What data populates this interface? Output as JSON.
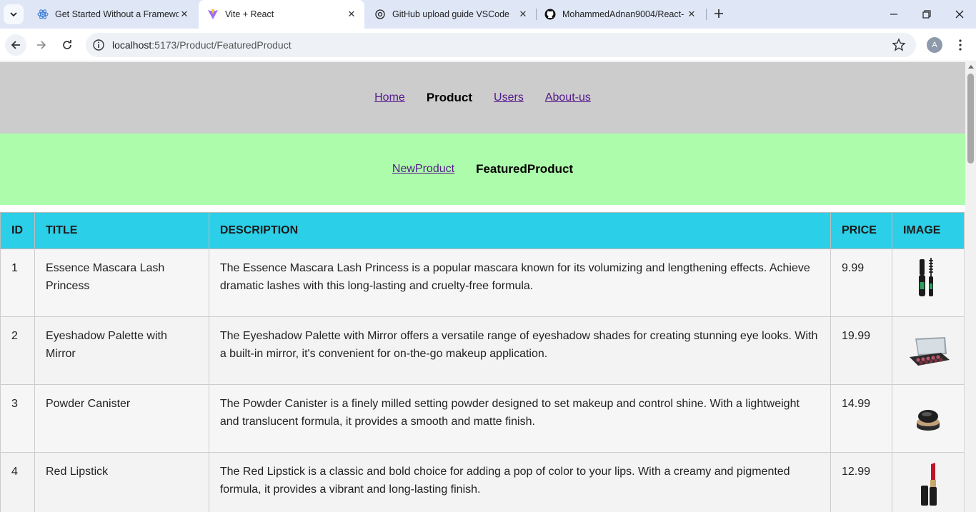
{
  "browser": {
    "tabs": [
      {
        "title": "Get Started Without a Framewo",
        "active": false,
        "icon": "react-icon"
      },
      {
        "title": "Vite + React",
        "active": true,
        "icon": "vite-icon"
      },
      {
        "title": "GitHub upload guide VSCode",
        "active": false,
        "icon": "chatgpt-icon"
      },
      {
        "title": "MohammedAdnan9004/React-",
        "active": false,
        "icon": "github-icon"
      }
    ],
    "url_host": "localhost",
    "url_path": ":5173/Product/FeaturedProduct",
    "profile_initial": "A"
  },
  "nav": {
    "home": "Home",
    "product": "Product",
    "users": "Users",
    "about": "About-us"
  },
  "subnav": {
    "new_product": "NewProduct",
    "featured_product": "FeaturedProduct"
  },
  "table": {
    "headers": [
      "ID",
      "TITLE",
      "DESCRIPTION",
      "PRICE",
      "IMAGE"
    ],
    "rows": [
      {
        "id": "1",
        "title": "Essence Mascara Lash Princess",
        "description": "The Essence Mascara Lash Princess is a popular mascara known for its volumizing and lengthening effects. Achieve dramatic lashes with this long-lasting and cruelty-free formula.",
        "price": "9.99",
        "image": "mascara-image"
      },
      {
        "id": "2",
        "title": "Eyeshadow Palette with Mirror",
        "description": "The Eyeshadow Palette with Mirror offers a versatile range of eyeshadow shades for creating stunning eye looks. With a built-in mirror, it's convenient for on-the-go makeup application.",
        "price": "19.99",
        "image": "eyeshadow-palette-image"
      },
      {
        "id": "3",
        "title": "Powder Canister",
        "description": "The Powder Canister is a finely milled setting powder designed to set makeup and control shine. With a lightweight and translucent formula, it provides a smooth and matte finish.",
        "price": "14.99",
        "image": "powder-canister-image"
      },
      {
        "id": "4",
        "title": "Red Lipstick",
        "description": "The Red Lipstick is a classic and bold choice for adding a pop of color to your lips. With a creamy and pigmented formula, it provides a vibrant and long-lasting finish.",
        "price": "12.99",
        "image": "red-lipstick-image"
      }
    ]
  },
  "colors": {
    "main_nav_bg": "#cccccc",
    "sub_nav_bg": "#adfcab",
    "table_header_bg": "#2ccfe8"
  }
}
